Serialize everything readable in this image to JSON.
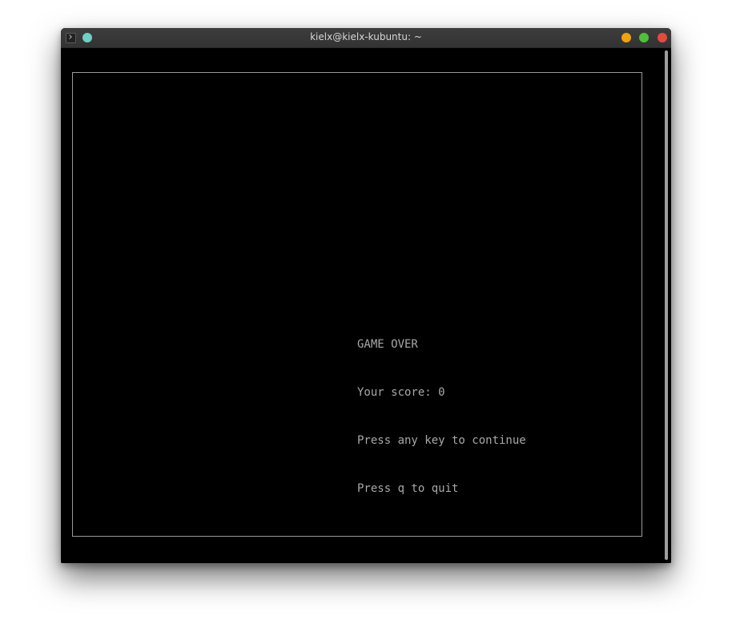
{
  "window": {
    "title": "kielx@kielx-kubuntu: ~"
  },
  "game": {
    "lines": [
      "GAME OVER",
      "Your score: 0",
      "Press any key to continue",
      "Press q to quit"
    ]
  },
  "colors": {
    "titlebar": "#383838",
    "terminal_bg": "#000000",
    "text": "#a8a8a8",
    "border": "#9a9a9a",
    "pin": "#6fd0c5",
    "minimize": "#f0a30a",
    "maximize": "#4cc239",
    "close": "#e8493d"
  },
  "icons": {
    "app": "terminal-icon",
    "pin": "pin-dot-icon",
    "minimize": "minimize-icon",
    "maximize": "maximize-icon",
    "close": "close-icon"
  }
}
